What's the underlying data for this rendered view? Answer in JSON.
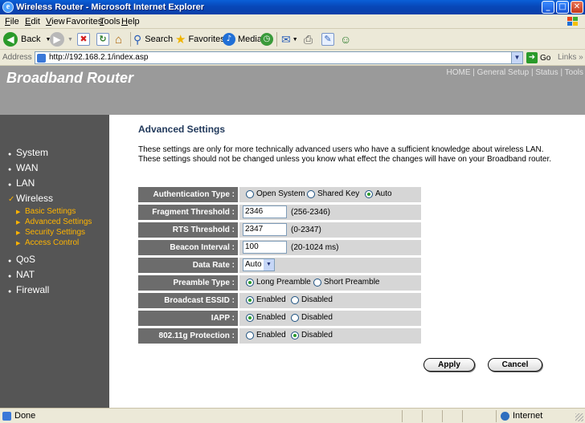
{
  "window": {
    "title": "Wireless Router - Microsoft Internet Explorer",
    "controls": {
      "minimize": "_",
      "maximize": "□",
      "close": "✕"
    }
  },
  "menu": {
    "items": [
      {
        "label": "File",
        "ul": "F",
        "rest": "ile"
      },
      {
        "label": "Edit",
        "ul": "E",
        "rest": "dit"
      },
      {
        "label": "View",
        "ul": "V",
        "rest": "iew"
      },
      {
        "label": "Favorites",
        "ul": "F",
        "rest": "avorites",
        "pre": "",
        "special": "a"
      },
      {
        "label": "Tools",
        "ul": "T",
        "rest": "ools"
      },
      {
        "label": "Help",
        "ul": "H",
        "rest": "elp"
      }
    ]
  },
  "toolbar": {
    "back": "Back",
    "search": "Search",
    "favorites": "Favorites",
    "media": "Media"
  },
  "address": {
    "label": "Address",
    "url": "http://192.168.2.1/index.asp",
    "go": "Go",
    "links": "Links »"
  },
  "header": {
    "brand": "Broadband Router",
    "topnav": "HOME | General Setup | Status | Tools"
  },
  "sidebar": {
    "items": [
      {
        "label": "System",
        "bullet": "●"
      },
      {
        "label": "WAN",
        "bullet": "●"
      },
      {
        "label": "LAN",
        "bullet": "●"
      },
      {
        "label": "Wireless",
        "bullet": "✓"
      },
      {
        "label": "QoS",
        "bullet": "●"
      },
      {
        "label": "NAT",
        "bullet": "●"
      },
      {
        "label": "Firewall",
        "bullet": "●"
      }
    ],
    "subitems": [
      "Basic Settings",
      "Advanced Settings",
      "Security Settings",
      "Access Control"
    ]
  },
  "main": {
    "title": "Advanced Settings",
    "description": "These settings are only for more technically advanced users who have a sufficient knowledge about wireless LAN. These settings should not be changed unless you know what effect the changes will have on your Broadband router."
  },
  "form": {
    "auth": {
      "label": "Authentication Type :",
      "options": [
        "Open System",
        "Shared Key",
        "Auto"
      ],
      "selected": "Auto"
    },
    "fragment": {
      "label": "Fragment Threshold :",
      "value": "2346",
      "hint": "(256-2346)"
    },
    "rts": {
      "label": "RTS Threshold :",
      "value": "2347",
      "hint": "(0-2347)"
    },
    "beacon": {
      "label": "Beacon Interval :",
      "value": "100",
      "hint": "(20-1024 ms)"
    },
    "datarate": {
      "label": "Data Rate :",
      "value": "Auto"
    },
    "preamble": {
      "label": "Preamble Type :",
      "options": [
        "Long Preamble",
        "Short Preamble"
      ],
      "selected": "Long Preamble"
    },
    "essid": {
      "label": "Broadcast ESSID :",
      "options": [
        "Enabled",
        "Disabled"
      ],
      "selected": "Enabled"
    },
    "iapp": {
      "label": "IAPP :",
      "options": [
        "Enabled",
        "Disabled"
      ],
      "selected": "Enabled"
    },
    "protection": {
      "label": "802.11g Protection :",
      "options": [
        "Enabled",
        "Disabled"
      ],
      "selected": "Disabled"
    }
  },
  "buttons": {
    "apply": "Apply",
    "cancel": "Cancel"
  },
  "status": {
    "left": "Done",
    "zone": "Internet"
  }
}
